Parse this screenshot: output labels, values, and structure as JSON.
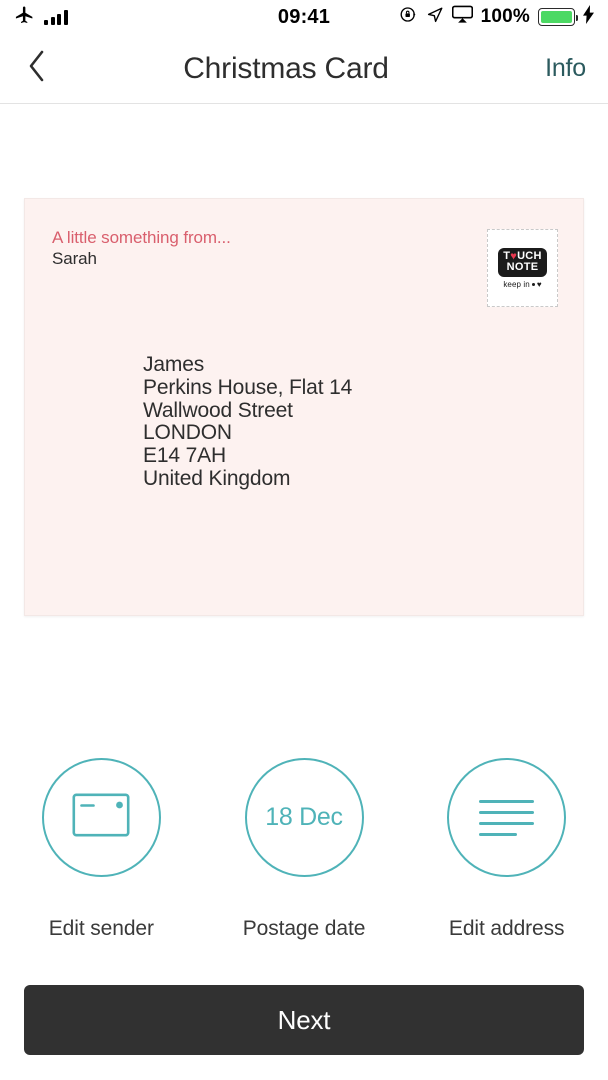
{
  "status_bar": {
    "airplane_icon": "airplane-mode-icon",
    "signal_icon": "signal-bars-icon",
    "time": "09:41",
    "rotation_lock_icon": "rotation-lock-icon",
    "location_icon": "location-arrow-icon",
    "airplay_icon": "airplay-screen-icon",
    "battery_percent": "100%",
    "battery_color": "#4cd964",
    "charging_icon": "lightning-bolt-icon"
  },
  "nav": {
    "back_icon": "chevron-left-icon",
    "title": "Christmas Card",
    "info_label": "Info",
    "info_color": "#2b5a5e"
  },
  "card": {
    "background_color": "#fdf2f0",
    "sender_label": "A little something from...",
    "sender_label_color": "#d95f6d",
    "sender_name": "Sarah",
    "stamp": {
      "brand_line1": "T UCH",
      "brand_line1_pre": "T",
      "brand_heart": "♥",
      "brand_line1_post": "UCH",
      "brand_line2": "NOTE",
      "tagline": "keep in",
      "heart_color": "#e8384f"
    },
    "address": [
      "James",
      "Perkins House, Flat 14",
      "Wallwood Street",
      "LONDON",
      "E14 7AH",
      "United Kingdom"
    ]
  },
  "actions": {
    "accent_color": "#4fb3b8",
    "items": [
      {
        "label": "Edit sender",
        "icon": "card-envelope-icon",
        "value": ""
      },
      {
        "label": "Postage date",
        "icon": "date-text",
        "value": "18 Dec"
      },
      {
        "label": "Edit address",
        "icon": "address-lines-icon",
        "value": ""
      }
    ]
  },
  "footer": {
    "next_label": "Next",
    "next_bg": "#313131"
  }
}
